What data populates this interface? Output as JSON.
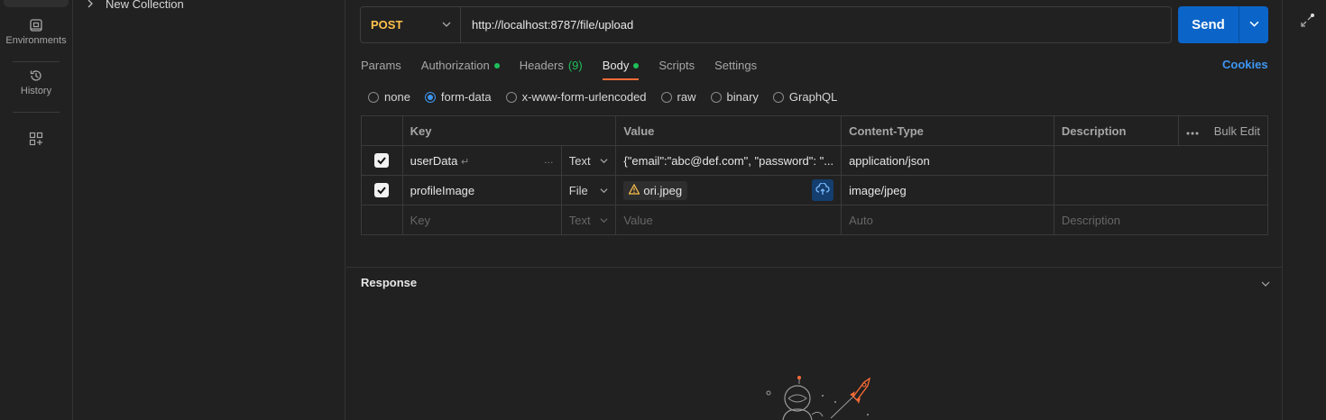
{
  "nav": {
    "items": [
      {
        "label": "Environments",
        "icon": "environments-icon"
      },
      {
        "label": "History",
        "icon": "history-icon"
      },
      {
        "label": "",
        "icon": "add-widget-icon"
      }
    ]
  },
  "tree": {
    "collection": "New Collection"
  },
  "request": {
    "method": "POST",
    "url": "http://localhost:8787/file/upload",
    "send_label": "Send"
  },
  "tabs": [
    {
      "label": "Params"
    },
    {
      "label": "Authorization"
    },
    {
      "label": "Headers",
      "count": "(9)"
    },
    {
      "label": "Body"
    },
    {
      "label": "Scripts"
    },
    {
      "label": "Settings"
    }
  ],
  "cookies_label": "Cookies",
  "body_types": [
    "none",
    "form-data",
    "x-www-form-urlencoded",
    "raw",
    "binary",
    "GraphQL"
  ],
  "body_selected": "form-data",
  "table": {
    "headers": [
      "Key",
      "Value",
      "Content-Type",
      "Description"
    ],
    "bulk_edit": "Bulk Edit",
    "rows": [
      {
        "key": "userData",
        "type": "Text",
        "value": "{\"email\":\"abc@def.com\", \"password\": \"...",
        "content_type": "application/json",
        "description": ""
      },
      {
        "key": "profileImage",
        "type": "File",
        "value": "ori.jpeg",
        "content_type": "image/jpeg",
        "description": ""
      }
    ],
    "placeholder": {
      "key": "Key",
      "type": "Text",
      "value": "Value",
      "content_type": "Auto",
      "description": "Description"
    }
  },
  "response": {
    "title": "Response"
  },
  "colors": {
    "accent": "#ff6c37",
    "send": "#0b65c9",
    "link": "#3d96f2",
    "method": "#ffc14d",
    "status_dot": "#1fbf5a"
  }
}
